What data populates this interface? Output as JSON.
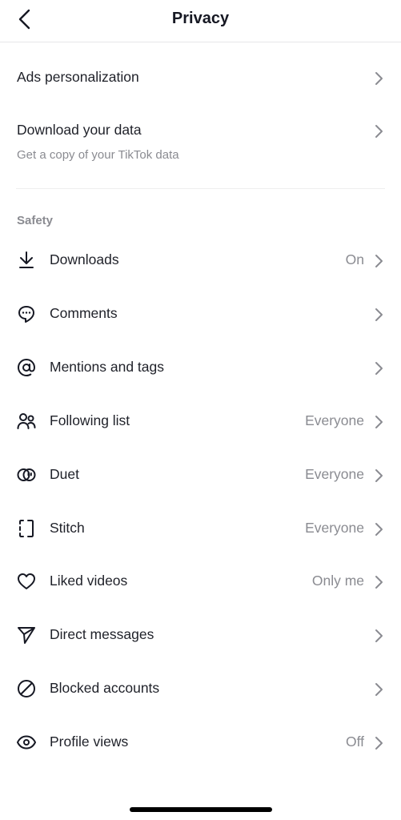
{
  "header": {
    "title": "Privacy",
    "back_icon": "chevron-left-icon"
  },
  "top_items": [
    {
      "label": "Ads personalization"
    },
    {
      "label": "Download your data",
      "subtitle": "Get a copy of your TikTok data"
    }
  ],
  "safety": {
    "section_label": "Safety",
    "items": [
      {
        "label": "Downloads",
        "value": "On",
        "icon": "download-icon"
      },
      {
        "label": "Comments",
        "value": "",
        "icon": "comment-icon"
      },
      {
        "label": "Mentions and tags",
        "value": "",
        "icon": "at-sign-icon"
      },
      {
        "label": "Following list",
        "value": "Everyone",
        "icon": "users-icon"
      },
      {
        "label": "Duet",
        "value": "Everyone",
        "icon": "duet-icon"
      },
      {
        "label": "Stitch",
        "value": "Everyone",
        "icon": "stitch-icon"
      },
      {
        "label": "Liked videos",
        "value": "Only me",
        "icon": "heart-icon"
      },
      {
        "label": "Direct messages",
        "value": "",
        "icon": "send-icon"
      },
      {
        "label": "Blocked accounts",
        "value": "",
        "icon": "block-icon"
      },
      {
        "label": "Profile views",
        "value": "Off",
        "icon": "eye-icon"
      }
    ]
  }
}
